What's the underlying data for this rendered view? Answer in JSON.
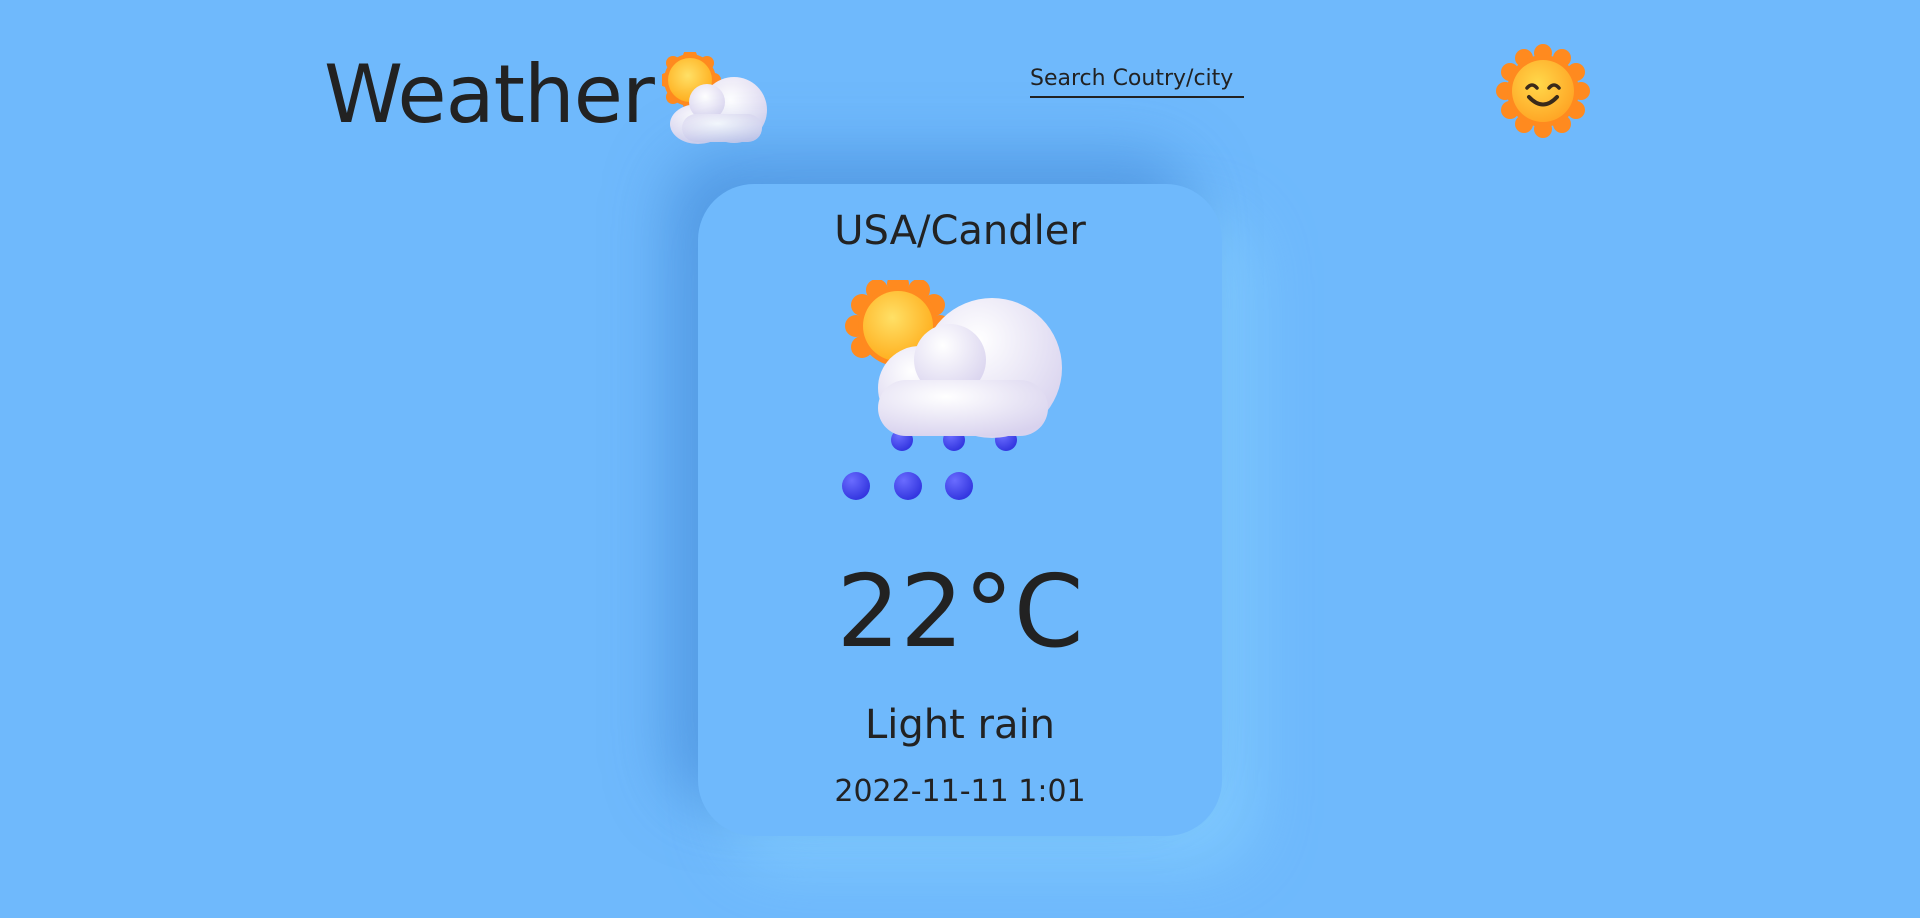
{
  "header": {
    "title": "Weather",
    "brand_icon": "sun-behind-cloud-icon",
    "search": {
      "placeholder": "Search Coutry/city",
      "value": ""
    },
    "profile_icon": "smiling-sun-icon"
  },
  "card": {
    "location": "USA/Candler",
    "condition_icon": "sun-cloud-rain-icon",
    "temperature": "22°C",
    "condition": "Light rain",
    "datetime": "2022-11-11 1:01"
  },
  "colors": {
    "background": "#6fb9fc",
    "text": "#222222",
    "sun": "#ffc42e",
    "sun_rays": "#ff8a1f",
    "rain": "#4a4df5",
    "cloud": "#f2f0fa"
  }
}
